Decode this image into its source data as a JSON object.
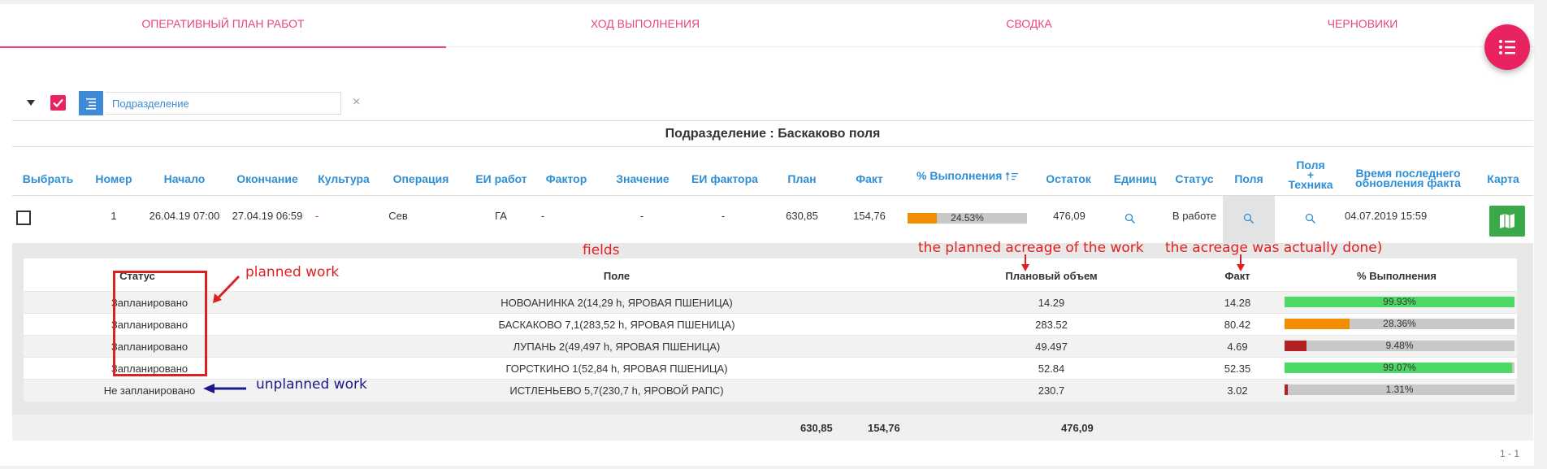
{
  "tabs": [
    {
      "label": "ОПЕРАТИВНЫЙ ПЛАН РАБОТ",
      "active": true
    },
    {
      "label": "ХОД ВЫПОЛНЕНИЯ",
      "active": false
    },
    {
      "label": "СВОДКА",
      "active": false
    },
    {
      "label": "ЧЕРНОВИКИ",
      "active": false
    }
  ],
  "filter": {
    "value": "Подразделение",
    "clear_symbol": "×"
  },
  "group_title": "Подразделение : Баскаково поля",
  "headers": {
    "select": "Выбрать",
    "number": "Номер",
    "start": "Начало",
    "end": "Окончание",
    "crop": "Культура",
    "operation": "Операция",
    "work_unit": "ЕИ работ",
    "factor": "Фактор",
    "value": "Значение",
    "factor_unit": "ЕИ фактора",
    "plan": "План",
    "fact": "Факт",
    "percent": "% Выполнения",
    "remainder": "Остаток",
    "units": "Единиц",
    "status": "Статус",
    "fields": "Поля",
    "fields_tech_line1": "Поля",
    "fields_tech_line2": "+",
    "fields_tech_line3": "Техника",
    "last_update_line1": "Время последнего",
    "last_update_line2": "обновления факта",
    "map": "Карта"
  },
  "row": {
    "number": "1",
    "start": "26.04.19 07:00",
    "end": "27.04.19 06:59",
    "crop": "-",
    "operation": "Сев",
    "work_unit": "ГА",
    "factor": "-",
    "value": "-",
    "factor_unit": "-",
    "plan": "630,85",
    "fact": "154,76",
    "percent": 24.53,
    "percent_label": "24.53%",
    "remainder": "476,09",
    "status": "В работе",
    "last_update": "04.07.2019 15:59"
  },
  "detail": {
    "headers": {
      "status": "Статус",
      "field": "Поле",
      "planned": "Плановый объем",
      "fact": "Факт",
      "percent": "% Выполнения"
    },
    "rows": [
      {
        "status": "Запланировано",
        "field": "НОВОАНИНКА 2(14,29 h, ЯРОВАЯ ПШЕНИЦА)",
        "planned": "14.29",
        "fact": "14.28",
        "percent": 99.93,
        "percent_label": "99.93%",
        "color": "#4cd964"
      },
      {
        "status": "Запланировано",
        "field": "БАСКАКОВО 7,1(283,52 h, ЯРОВАЯ ПШЕНИЦА)",
        "planned": "283.52",
        "fact": "80.42",
        "percent": 28.36,
        "percent_label": "28.36%",
        "color": "#f28c00"
      },
      {
        "status": "Запланировано",
        "field": "ЛУПАНЬ 2(49,497 h, ЯРОВАЯ ПШЕНИЦА)",
        "planned": "49.497",
        "fact": "4.69",
        "percent": 9.48,
        "percent_label": "9.48%",
        "color": "#b22222"
      },
      {
        "status": "Запланировано",
        "field": "ГОРСТКИНО 1(52,84 h, ЯРОВАЯ ПШЕНИЦА)",
        "planned": "52.84",
        "fact": "52.35",
        "percent": 99.07,
        "percent_label": "99.07%",
        "color": "#4cd964"
      },
      {
        "status": "Не запланировано",
        "field": "ИСТЛЕНЬЕВО 5,7(230,7 h, ЯРОВОЙ РАПС)",
        "planned": "230.7",
        "fact": "3.02",
        "percent": 1.31,
        "percent_label": "1.31%",
        "color": "#b22222"
      }
    ]
  },
  "totals": {
    "plan": "630,85",
    "fact": "154,76",
    "remainder": "476,09"
  },
  "pager": "1 - 1",
  "annotations": {
    "fields": "fields",
    "planned_acreage": "the planned acreage of the work",
    "actual_acreage": "the acreage was actually done)",
    "planned_work": "planned work",
    "unplanned_work": "unplanned work"
  },
  "colors": {
    "accent_pink": "#e8467c",
    "link_blue": "#2e8fd6",
    "progress_orange": "#f28c00",
    "map_green": "#3aa94a"
  }
}
